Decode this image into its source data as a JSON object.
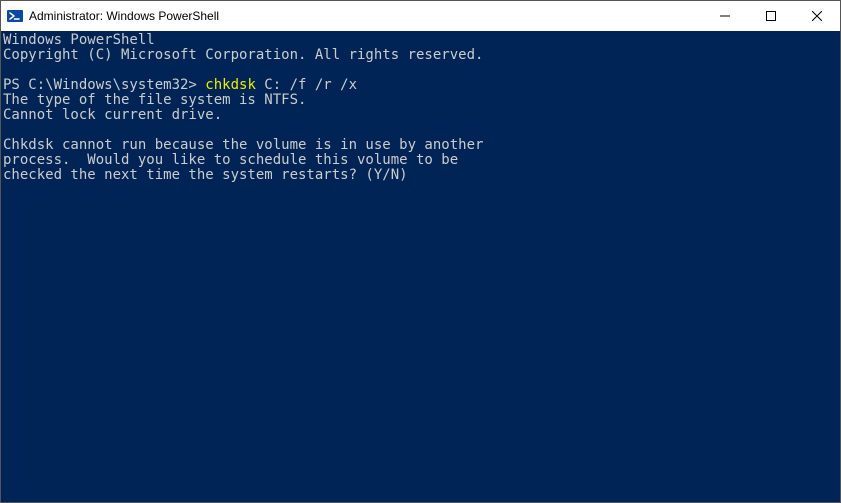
{
  "window": {
    "title": "Administrator: Windows PowerShell"
  },
  "terminal": {
    "banner_line1": "Windows PowerShell",
    "banner_line2": "Copyright (C) Microsoft Corporation. All rights reserved.",
    "prompt_prefix": "PS C:\\Windows\\system32> ",
    "command": "chkdsk",
    "command_args": " C: /f /r /x",
    "output_line1": "The type of the file system is NTFS.",
    "output_line2": "Cannot lock current drive.",
    "output_line3": "Chkdsk cannot run because the volume is in use by another",
    "output_line4": "process.  Would you like to schedule this volume to be",
    "output_line5": "checked the next time the system restarts? (Y/N)"
  }
}
